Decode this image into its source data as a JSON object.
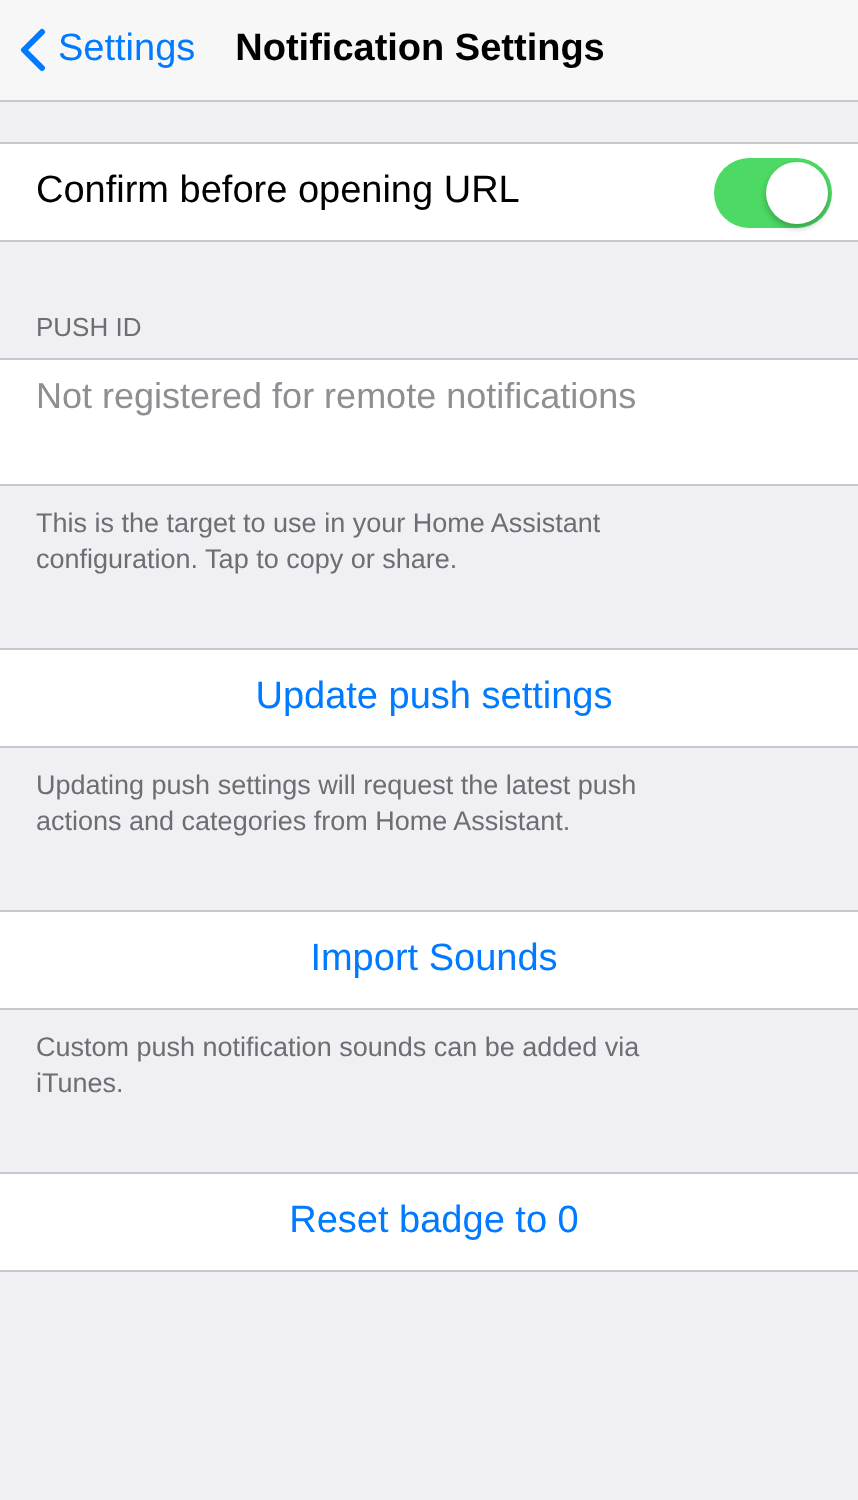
{
  "nav": {
    "back_label": "Settings",
    "title": "Notification Settings"
  },
  "sections": [
    {
      "kind": "toggle",
      "label": "Confirm before opening URL",
      "on": true
    },
    {
      "kind": "info",
      "header": "PUSH ID",
      "value": "Not registered for remote notifications",
      "footer": "This is the target to use in your Home Assistant configuration. Tap to copy or share."
    },
    {
      "kind": "action",
      "label": "Update push settings",
      "footer": "Updating push settings will request the latest push actions and categories from Home Assistant."
    },
    {
      "kind": "action",
      "label": "Import Sounds",
      "footer": "Custom push notification sounds can be added via iTunes."
    },
    {
      "kind": "action",
      "label": "Reset badge to 0"
    }
  ]
}
